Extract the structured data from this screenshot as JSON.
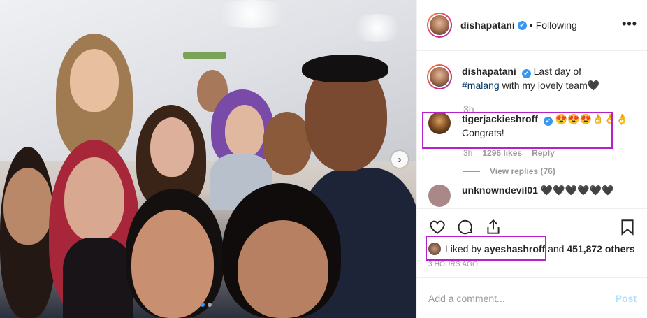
{
  "header": {
    "username": "dishapatani",
    "verified_mark": "✔",
    "separator": "•",
    "follow_status": "Following",
    "more": "•••"
  },
  "caption": {
    "username": "dishapatani",
    "text_before": "Last day of",
    "hashtag": "#malang",
    "text_after": "with my lovely team🖤",
    "time": "3h"
  },
  "comment": {
    "username": "tigerjackieshroff",
    "emojis": "😍😍😍👌👌👌",
    "text": "Congrats!",
    "time": "3h",
    "likes": "1296 likes",
    "reply": "Reply",
    "view_replies": "View replies (76)"
  },
  "next_comment": {
    "username": "unknowndevil01",
    "emojis": "🖤🖤🖤🖤🖤🖤"
  },
  "likes": {
    "prefix": "Liked by",
    "user": "ayeshashroff",
    "suffix": "and",
    "count": "451,872 others"
  },
  "timestamp": "3 HOURS AGO",
  "add_comment": {
    "placeholder": "Add a comment...",
    "post": "Post"
  },
  "carousel": {
    "current": 1,
    "total": 2
  },
  "colors": {
    "highlight": "#b620c8",
    "link": "#003569",
    "verified": "#3897f0"
  },
  "icons": [
    "heart-icon",
    "comment-icon",
    "share-icon",
    "bookmark-icon",
    "chevron-right-icon"
  ]
}
